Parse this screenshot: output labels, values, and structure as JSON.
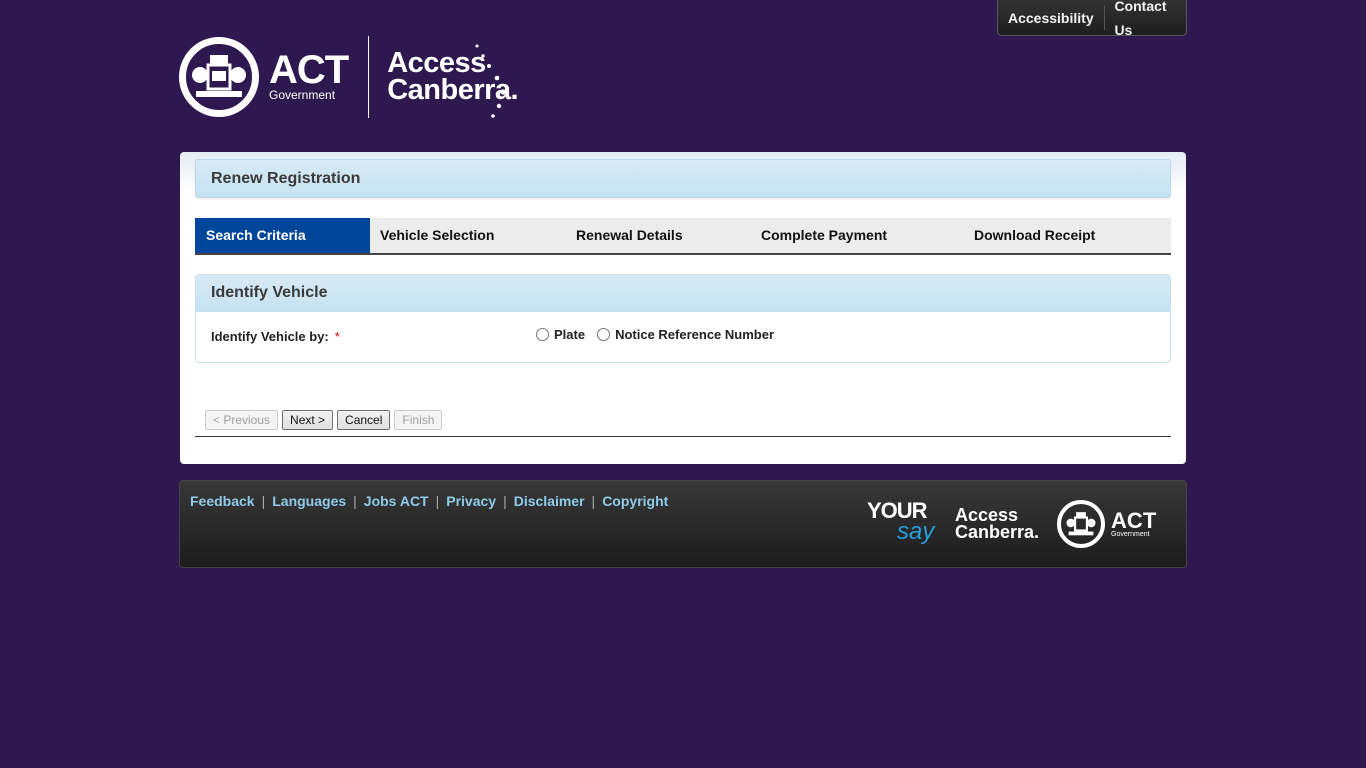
{
  "utility_nav": {
    "items": [
      {
        "label": "Accessibility"
      },
      {
        "label": "Contact Us"
      }
    ]
  },
  "header": {
    "act_logo": {
      "title": "ACT",
      "subtitle": "Government",
      "icon": "act-crest-icon"
    },
    "access_canberra_logo": {
      "line1": "Access",
      "line2": "Canberra."
    }
  },
  "page": {
    "title": "Renew Registration",
    "steps": [
      {
        "label": "Search Criteria",
        "active": true
      },
      {
        "label": "Vehicle Selection",
        "active": false
      },
      {
        "label": "Renewal Details",
        "active": false
      },
      {
        "label": "Complete Payment",
        "active": false
      },
      {
        "label": "Download Receipt",
        "active": false
      }
    ],
    "section": {
      "title": "Identify Vehicle",
      "field_label": "Identify Vehicle by:",
      "required_marker": "*",
      "options": [
        {
          "label": "Plate",
          "selected": false
        },
        {
          "label": "Notice Reference Number",
          "selected": false
        }
      ]
    },
    "buttons": {
      "previous": {
        "label": "< Previous",
        "disabled": true
      },
      "next": {
        "label": "Next >",
        "disabled": false
      },
      "cancel": {
        "label": "Cancel",
        "disabled": false
      },
      "finish": {
        "label": "Finish",
        "disabled": true
      }
    }
  },
  "footer": {
    "links": [
      {
        "label": "Feedback"
      },
      {
        "label": "Languages"
      },
      {
        "label": "Jobs ACT"
      },
      {
        "label": "Privacy"
      },
      {
        "label": "Disclaimer"
      },
      {
        "label": "Copyright"
      }
    ],
    "logos": {
      "yoursay": {
        "line1": "YOUR",
        "line2": "say"
      },
      "access_canberra": {
        "line1": "Access",
        "line2": "Canberra."
      },
      "act": {
        "title": "ACT",
        "subtitle": "Government"
      }
    }
  },
  "colors": {
    "background": "#2e1850",
    "active_step": "#00469a",
    "footer_link": "#8fcbe8",
    "required": "#cc0000"
  }
}
